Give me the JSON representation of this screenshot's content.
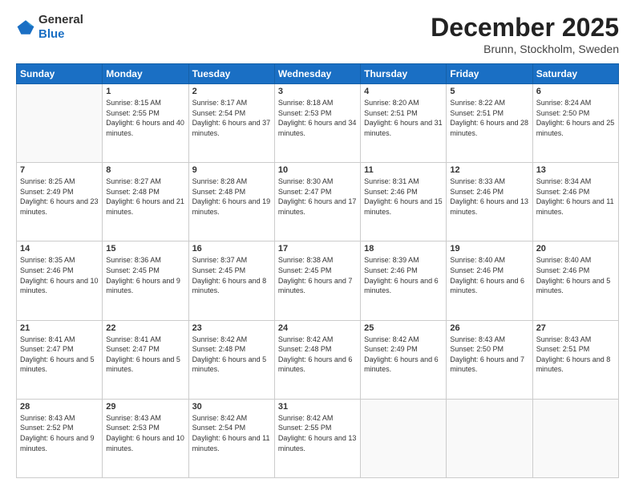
{
  "header": {
    "logo_line1": "General",
    "logo_line2": "Blue",
    "month_title": "December 2025",
    "location": "Brunn, Stockholm, Sweden"
  },
  "weekdays": [
    "Sunday",
    "Monday",
    "Tuesday",
    "Wednesday",
    "Thursday",
    "Friday",
    "Saturday"
  ],
  "weeks": [
    [
      {
        "day": "",
        "sunrise": "",
        "sunset": "",
        "daylight": ""
      },
      {
        "day": "1",
        "sunrise": "Sunrise: 8:15 AM",
        "sunset": "Sunset: 2:55 PM",
        "daylight": "Daylight: 6 hours and 40 minutes."
      },
      {
        "day": "2",
        "sunrise": "Sunrise: 8:17 AM",
        "sunset": "Sunset: 2:54 PM",
        "daylight": "Daylight: 6 hours and 37 minutes."
      },
      {
        "day": "3",
        "sunrise": "Sunrise: 8:18 AM",
        "sunset": "Sunset: 2:53 PM",
        "daylight": "Daylight: 6 hours and 34 minutes."
      },
      {
        "day": "4",
        "sunrise": "Sunrise: 8:20 AM",
        "sunset": "Sunset: 2:51 PM",
        "daylight": "Daylight: 6 hours and 31 minutes."
      },
      {
        "day": "5",
        "sunrise": "Sunrise: 8:22 AM",
        "sunset": "Sunset: 2:51 PM",
        "daylight": "Daylight: 6 hours and 28 minutes."
      },
      {
        "day": "6",
        "sunrise": "Sunrise: 8:24 AM",
        "sunset": "Sunset: 2:50 PM",
        "daylight": "Daylight: 6 hours and 25 minutes."
      }
    ],
    [
      {
        "day": "7",
        "sunrise": "Sunrise: 8:25 AM",
        "sunset": "Sunset: 2:49 PM",
        "daylight": "Daylight: 6 hours and 23 minutes."
      },
      {
        "day": "8",
        "sunrise": "Sunrise: 8:27 AM",
        "sunset": "Sunset: 2:48 PM",
        "daylight": "Daylight: 6 hours and 21 minutes."
      },
      {
        "day": "9",
        "sunrise": "Sunrise: 8:28 AM",
        "sunset": "Sunset: 2:48 PM",
        "daylight": "Daylight: 6 hours and 19 minutes."
      },
      {
        "day": "10",
        "sunrise": "Sunrise: 8:30 AM",
        "sunset": "Sunset: 2:47 PM",
        "daylight": "Daylight: 6 hours and 17 minutes."
      },
      {
        "day": "11",
        "sunrise": "Sunrise: 8:31 AM",
        "sunset": "Sunset: 2:46 PM",
        "daylight": "Daylight: 6 hours and 15 minutes."
      },
      {
        "day": "12",
        "sunrise": "Sunrise: 8:33 AM",
        "sunset": "Sunset: 2:46 PM",
        "daylight": "Daylight: 6 hours and 13 minutes."
      },
      {
        "day": "13",
        "sunrise": "Sunrise: 8:34 AM",
        "sunset": "Sunset: 2:46 PM",
        "daylight": "Daylight: 6 hours and 11 minutes."
      }
    ],
    [
      {
        "day": "14",
        "sunrise": "Sunrise: 8:35 AM",
        "sunset": "Sunset: 2:46 PM",
        "daylight": "Daylight: 6 hours and 10 minutes."
      },
      {
        "day": "15",
        "sunrise": "Sunrise: 8:36 AM",
        "sunset": "Sunset: 2:45 PM",
        "daylight": "Daylight: 6 hours and 9 minutes."
      },
      {
        "day": "16",
        "sunrise": "Sunrise: 8:37 AM",
        "sunset": "Sunset: 2:45 PM",
        "daylight": "Daylight: 6 hours and 8 minutes."
      },
      {
        "day": "17",
        "sunrise": "Sunrise: 8:38 AM",
        "sunset": "Sunset: 2:45 PM",
        "daylight": "Daylight: 6 hours and 7 minutes."
      },
      {
        "day": "18",
        "sunrise": "Sunrise: 8:39 AM",
        "sunset": "Sunset: 2:46 PM",
        "daylight": "Daylight: 6 hours and 6 minutes."
      },
      {
        "day": "19",
        "sunrise": "Sunrise: 8:40 AM",
        "sunset": "Sunset: 2:46 PM",
        "daylight": "Daylight: 6 hours and 6 minutes."
      },
      {
        "day": "20",
        "sunrise": "Sunrise: 8:40 AM",
        "sunset": "Sunset: 2:46 PM",
        "daylight": "Daylight: 6 hours and 5 minutes."
      }
    ],
    [
      {
        "day": "21",
        "sunrise": "Sunrise: 8:41 AM",
        "sunset": "Sunset: 2:47 PM",
        "daylight": "Daylight: 6 hours and 5 minutes."
      },
      {
        "day": "22",
        "sunrise": "Sunrise: 8:41 AM",
        "sunset": "Sunset: 2:47 PM",
        "daylight": "Daylight: 6 hours and 5 minutes."
      },
      {
        "day": "23",
        "sunrise": "Sunrise: 8:42 AM",
        "sunset": "Sunset: 2:48 PM",
        "daylight": "Daylight: 6 hours and 5 minutes."
      },
      {
        "day": "24",
        "sunrise": "Sunrise: 8:42 AM",
        "sunset": "Sunset: 2:48 PM",
        "daylight": "Daylight: 6 hours and 6 minutes."
      },
      {
        "day": "25",
        "sunrise": "Sunrise: 8:42 AM",
        "sunset": "Sunset: 2:49 PM",
        "daylight": "Daylight: 6 hours and 6 minutes."
      },
      {
        "day": "26",
        "sunrise": "Sunrise: 8:43 AM",
        "sunset": "Sunset: 2:50 PM",
        "daylight": "Daylight: 6 hours and 7 minutes."
      },
      {
        "day": "27",
        "sunrise": "Sunrise: 8:43 AM",
        "sunset": "Sunset: 2:51 PM",
        "daylight": "Daylight: 6 hours and 8 minutes."
      }
    ],
    [
      {
        "day": "28",
        "sunrise": "Sunrise: 8:43 AM",
        "sunset": "Sunset: 2:52 PM",
        "daylight": "Daylight: 6 hours and 9 minutes."
      },
      {
        "day": "29",
        "sunrise": "Sunrise: 8:43 AM",
        "sunset": "Sunset: 2:53 PM",
        "daylight": "Daylight: 6 hours and 10 minutes."
      },
      {
        "day": "30",
        "sunrise": "Sunrise: 8:42 AM",
        "sunset": "Sunset: 2:54 PM",
        "daylight": "Daylight: 6 hours and 11 minutes."
      },
      {
        "day": "31",
        "sunrise": "Sunrise: 8:42 AM",
        "sunset": "Sunset: 2:55 PM",
        "daylight": "Daylight: 6 hours and 13 minutes."
      },
      {
        "day": "",
        "sunrise": "",
        "sunset": "",
        "daylight": ""
      },
      {
        "day": "",
        "sunrise": "",
        "sunset": "",
        "daylight": ""
      },
      {
        "day": "",
        "sunrise": "",
        "sunset": "",
        "daylight": ""
      }
    ]
  ]
}
